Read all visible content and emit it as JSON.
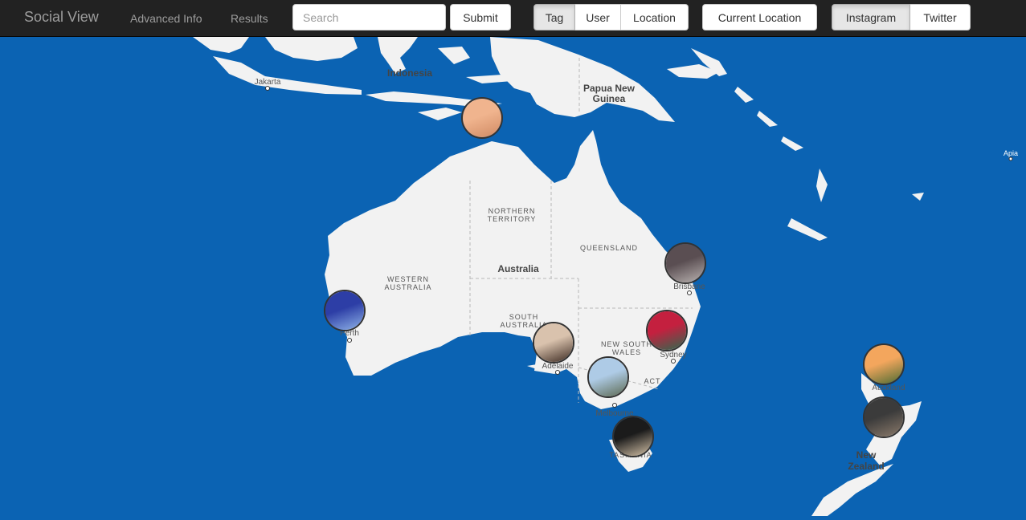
{
  "navbar": {
    "brand": "Social View",
    "links": [
      "Advanced Info",
      "Results"
    ],
    "search_placeholder": "Search",
    "submit_label": "Submit",
    "mode_buttons": [
      "Tag",
      "User",
      "Location"
    ],
    "active_mode": "Tag",
    "current_location_label": "Current Location",
    "source_buttons": [
      "Instagram",
      "Twitter"
    ],
    "active_source": "Instagram"
  },
  "map": {
    "colors": {
      "water": "#0b63b3",
      "land": "#f2f2f2"
    },
    "place_labels": {
      "indonesia": "Indonesia",
      "jakarta": "Jakarta",
      "png_1": "Papua New",
      "png_2": "Guinea",
      "apia": "Apia",
      "nt_1": "NORTHERN",
      "nt_2": "TERRITORY",
      "qld": "QUEENSLAND",
      "australia": "Australia",
      "wa_1": "WESTERN",
      "wa_2": "AUSTRALIA",
      "sa_1": "SOUTH",
      "sa_2": "AUSTRALIA",
      "nsw_1": "NEW SOUTH",
      "nsw_2": "WALES",
      "act": "ACT",
      "brisbane": "Brisbane",
      "sydney": "Sydney",
      "perth": "Perth",
      "adelaide": "Adelaide",
      "melbourne": "Melbourne",
      "tasmania": "TASMANIA",
      "auckland": "Auckland",
      "nz_1": "New",
      "nz_2": "Zealand"
    },
    "markers": [
      {
        "name": "darwin-area",
        "place": "Timor Sea",
        "colors": [
          "#f0b48e",
          "#d08a63"
        ]
      },
      {
        "name": "brisbane",
        "place": "Brisbane",
        "colors": [
          "#5a4e52",
          "#b9b2b0"
        ]
      },
      {
        "name": "sydney",
        "place": "Sydney",
        "colors": [
          "#c4203f",
          "#2d6a4f"
        ]
      },
      {
        "name": "perth",
        "place": "Perth",
        "colors": [
          "#2d3ea6",
          "#8fb3e8"
        ]
      },
      {
        "name": "adelaide",
        "place": "Adelaide",
        "colors": [
          "#d9c2ad",
          "#3d2b22"
        ]
      },
      {
        "name": "melbourne",
        "place": "Melbourne",
        "colors": [
          "#aecbe6",
          "#5d6a52"
        ]
      },
      {
        "name": "tasmania",
        "place": "Tasmania",
        "colors": [
          "#1b1b1b",
          "#d6c3a8"
        ]
      },
      {
        "name": "auckland",
        "place": "Auckland",
        "colors": [
          "#f3a65d",
          "#4d6b33"
        ]
      },
      {
        "name": "nz-north",
        "place": "New Zealand",
        "colors": [
          "#3b3b3b",
          "#8c7b6b"
        ]
      }
    ]
  }
}
